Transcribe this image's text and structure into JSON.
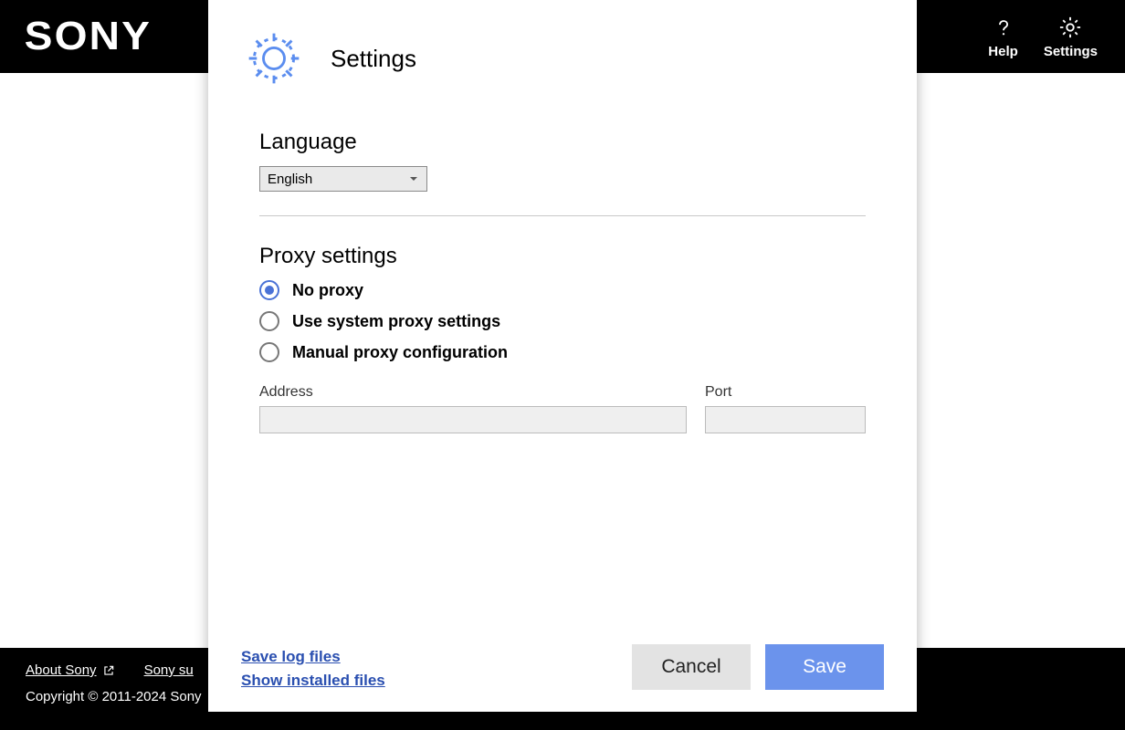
{
  "topbar": {
    "brand": "SONY",
    "help_label": "Help",
    "settings_label": "Settings"
  },
  "modal": {
    "title": "Settings",
    "language": {
      "heading": "Language",
      "selected": "English"
    },
    "proxy": {
      "heading": "Proxy settings",
      "options": {
        "none": "No proxy",
        "system": "Use system proxy settings",
        "manual": "Manual proxy configuration"
      },
      "selected": "none",
      "address_label": "Address",
      "address_value": "",
      "port_label": "Port",
      "port_value": ""
    },
    "links": {
      "save_logs": "Save log files",
      "show_files": "Show installed files"
    },
    "buttons": {
      "cancel": "Cancel",
      "save": "Save"
    }
  },
  "footer": {
    "about": "About Sony",
    "support": "Sony su",
    "copyright": "Copyright © 2011-2024 Sony"
  }
}
